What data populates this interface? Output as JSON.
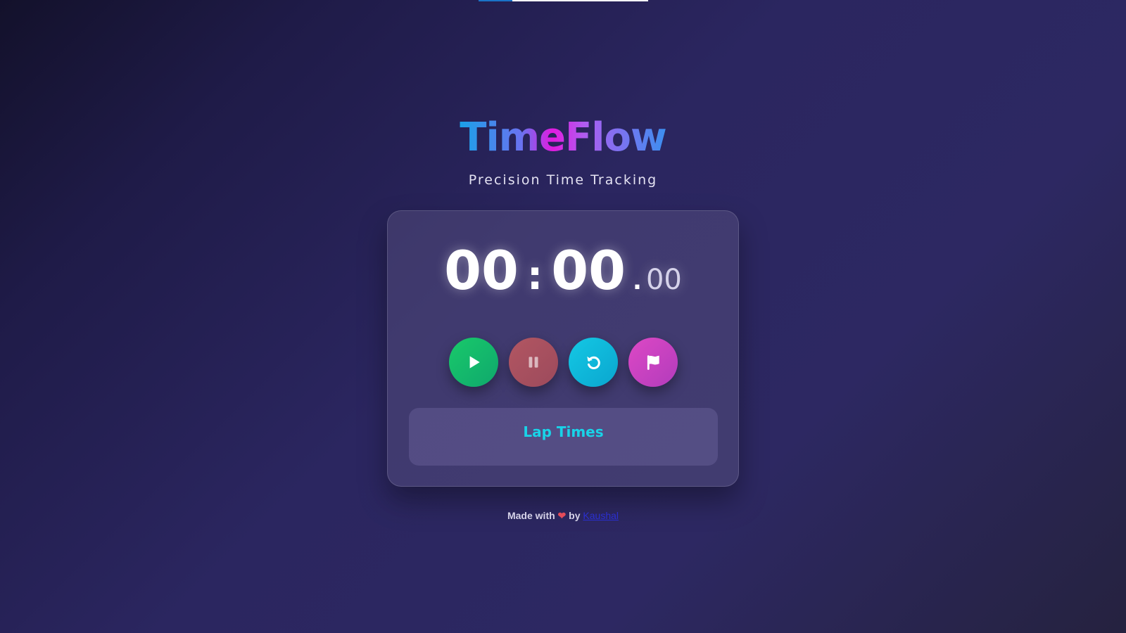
{
  "top_progress": {
    "fraction": 0.2
  },
  "header": {
    "title": "TimeFlow",
    "subtitle": "Precision Time Tracking"
  },
  "timer": {
    "minutes": "00",
    "colon": ":",
    "seconds": "00",
    "dot": ".",
    "centiseconds": "00"
  },
  "controls": {
    "start_icon": "play-icon",
    "pause_icon": "pause-icon",
    "reset_icon": "reset-icon",
    "lap_icon": "flag-icon",
    "colors": {
      "start": "#12b86b",
      "pause": "#a65060",
      "reset": "#10b8dc",
      "lap": "#c842c1"
    }
  },
  "laps": {
    "title": "Lap Times"
  },
  "footer": {
    "prefix": "Made with",
    "heart": "❤",
    "by": "by",
    "author": "Kaushal"
  }
}
